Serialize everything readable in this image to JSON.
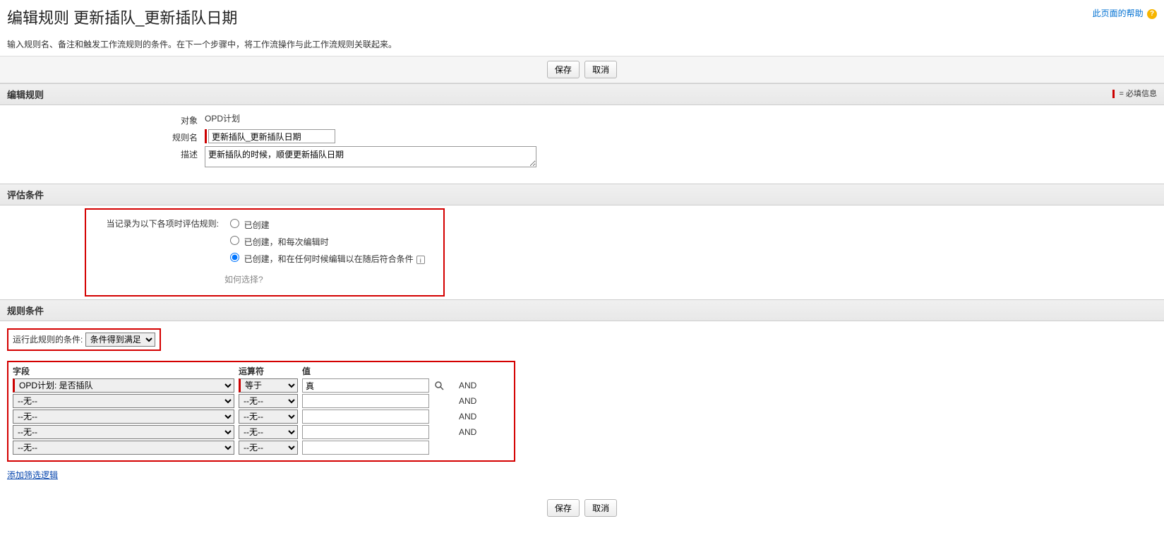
{
  "helpLink": "此页面的帮助",
  "pageTitle": "编辑规则 更新插队_更新插队日期",
  "pageDesc": "输入规则名、备注和触发工作流规则的条件。在下一个步骤中，将工作流操作与此工作流规则关联起来。",
  "buttons": {
    "save": "保存",
    "cancel": "取消"
  },
  "sections": {
    "edit": "编辑规则",
    "eval": "评估条件",
    "criteria": "规则条件"
  },
  "requiredNote": "= 必填信息",
  "labels": {
    "object": "对象",
    "ruleName": "规则名",
    "description": "描述",
    "evalWhen": "当记录为以下各项时评估规则:",
    "howChoose": "如何选择?",
    "runIf": "运行此规则的条件:",
    "field": "字段",
    "operator": "运算符",
    "value": "值",
    "and": "AND",
    "addFilter": "添加筛选逻辑"
  },
  "form": {
    "objectValue": "OPD计划",
    "ruleNameValue": "更新插队_更新插队日期",
    "descriptionValue": "更新插队的时候，顺便更新插队日期"
  },
  "evalOptions": [
    {
      "label": "已创建",
      "checked": false
    },
    {
      "label": "已创建，和每次编辑时",
      "checked": false
    },
    {
      "label": "已创建，和在任何时候编辑以在随后符合条件",
      "checked": true
    }
  ],
  "runIfSelect": {
    "value": "条件得到满足"
  },
  "noneOption": "--无--",
  "equalsOption": "等于",
  "criteriaRows": [
    {
      "field": "OPD计划: 是否插队",
      "op": "等于",
      "value": "真",
      "lookup": true,
      "and": true
    },
    {
      "field": "--无--",
      "op": "--无--",
      "value": "",
      "and": true
    },
    {
      "field": "--无--",
      "op": "--无--",
      "value": "",
      "and": true
    },
    {
      "field": "--无--",
      "op": "--无--",
      "value": "",
      "and": true
    },
    {
      "field": "--无--",
      "op": "--无--",
      "value": "",
      "and": false
    }
  ]
}
